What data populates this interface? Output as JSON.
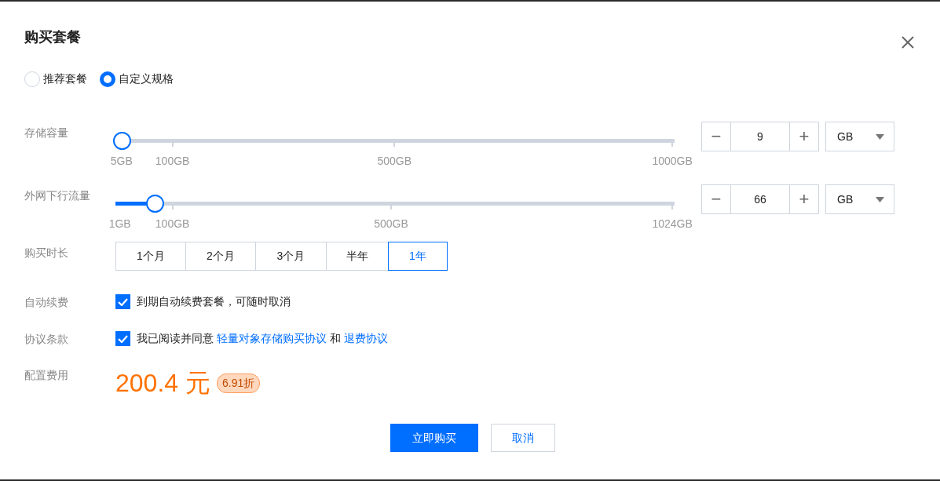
{
  "dialog": {
    "title": "购买套餐"
  },
  "plan_options": [
    {
      "label": "推荐套餐",
      "selected": false
    },
    {
      "label": "自定义规格",
      "selected": true
    }
  ],
  "sliders": [
    {
      "label": "存储容量",
      "level": 0.011,
      "ticks": [
        "5GB",
        "100GB",
        "500GB",
        "1000GB"
      ],
      "minus": "−",
      "value": "9",
      "plus": "+",
      "unit": "GB"
    },
    {
      "label": "外网下行流量",
      "level": 0.07,
      "ticks": [
        "1GB",
        "100GB",
        "500GB",
        "1024GB"
      ],
      "minus": "−",
      "value": "66",
      "plus": "+",
      "unit": "GB"
    }
  ],
  "duration": {
    "label": "购买时长",
    "options": [
      {
        "label": "1个月",
        "selected": false
      },
      {
        "label": "2个月",
        "selected": false
      },
      {
        "label": "3个月",
        "selected": false
      },
      {
        "label": "半年",
        "selected": false
      },
      {
        "label": "1年",
        "selected": true
      }
    ]
  },
  "auto_renew": {
    "label": "自动续费",
    "checked": true,
    "text": "到期自动续费套餐，可随时取消"
  },
  "agreement": {
    "label": "协议条款",
    "checked": true,
    "text": "我已阅读并同意",
    "link1": "轻量对象存储购买协议",
    "and": "和",
    "link2": "退费协议"
  },
  "price": {
    "label": "配置费用",
    "amount": "200.4 元",
    "discount": "6.91折"
  },
  "buttons": [
    {
      "label": "立即购买",
      "kind": "primary"
    },
    {
      "label": "取消",
      "kind": "secondary"
    }
  ]
}
